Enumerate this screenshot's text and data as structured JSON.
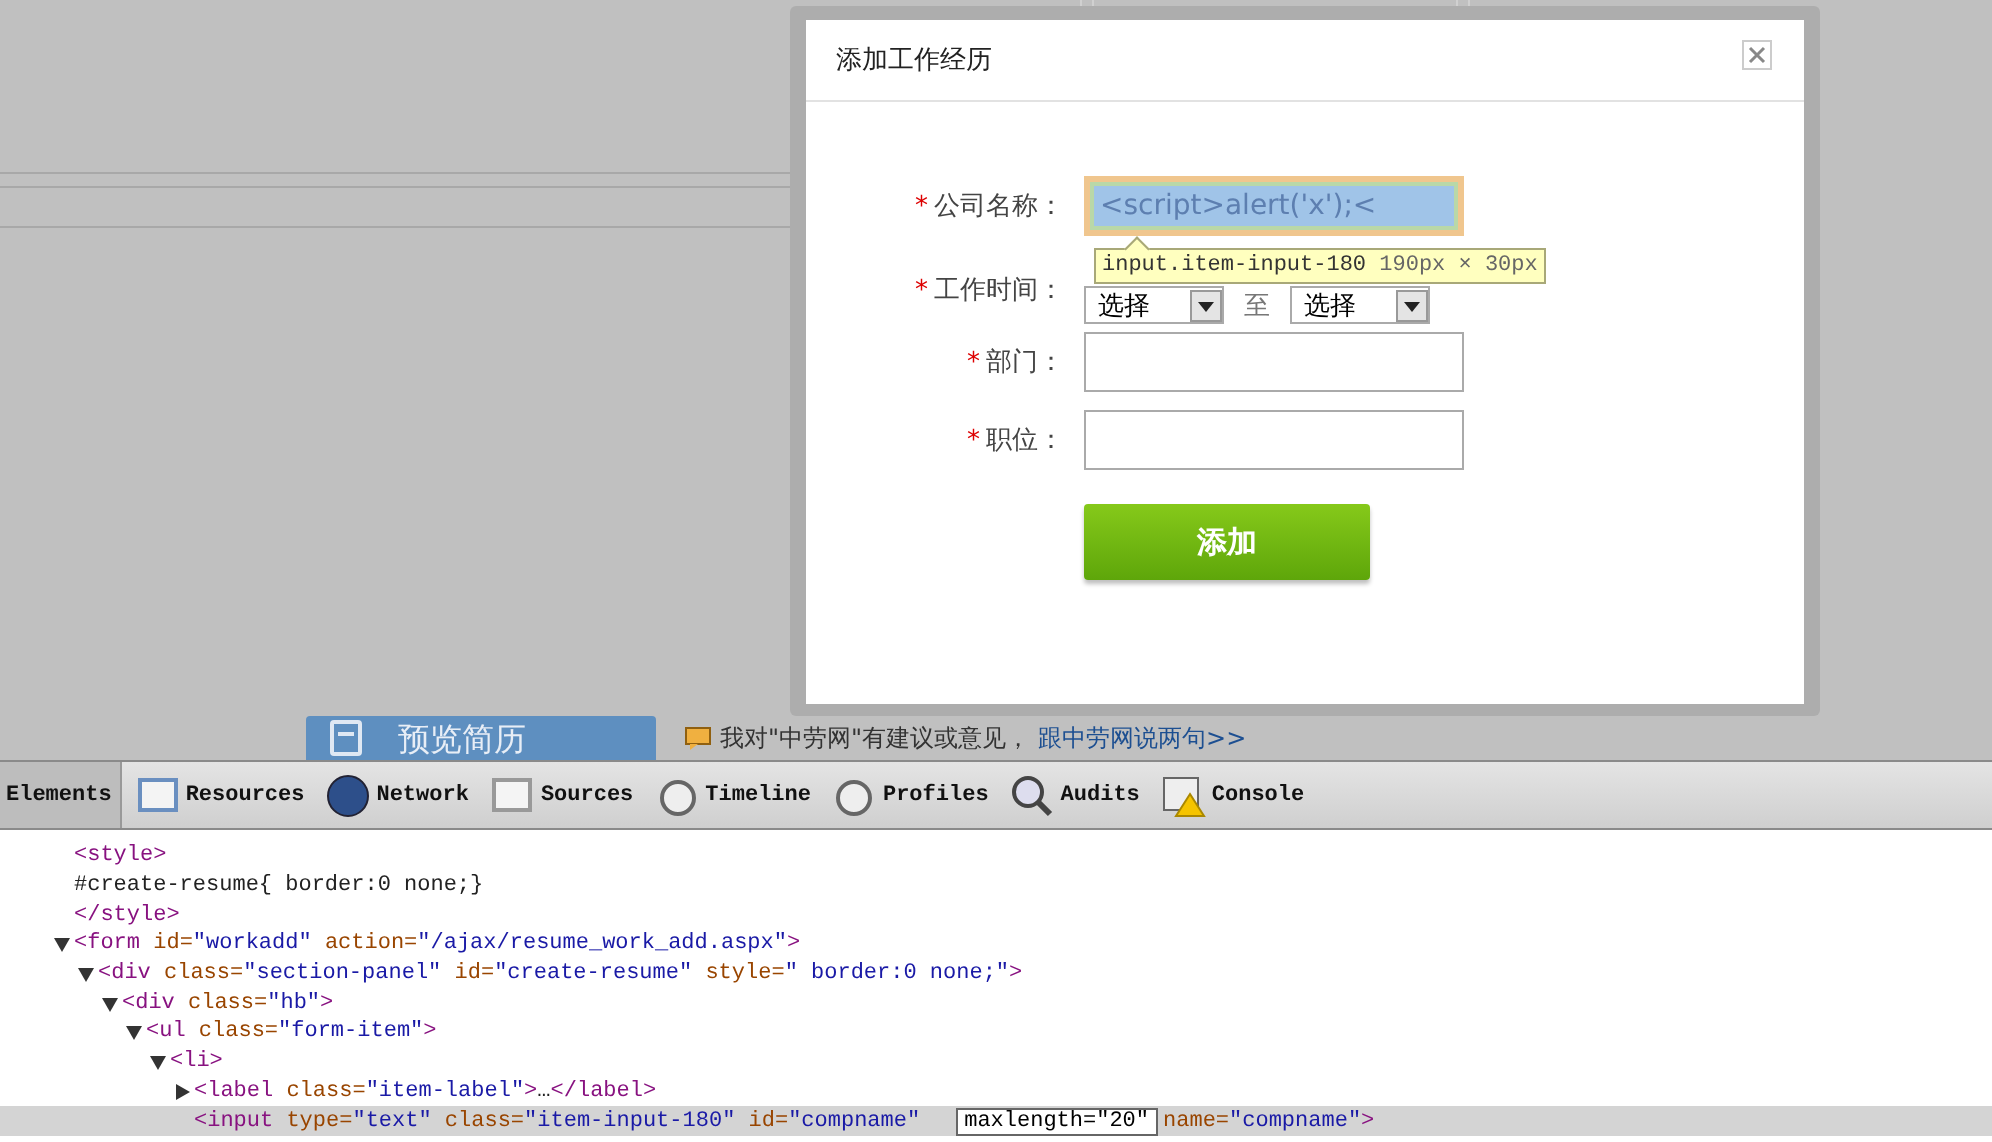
{
  "page": {
    "preview_button": {
      "label": "预览简历"
    },
    "feedback": {
      "text": "我对\"中劳网\"有建议或意见，",
      "link": "跟中劳网说两句>>"
    }
  },
  "dialog": {
    "title": "添加工作经历",
    "fields": [
      {
        "kind": "input",
        "mark": "*",
        "label": "公司名称：",
        "value": "<script>alert('x');<",
        "inspected": true
      },
      {
        "kind": "date-range",
        "mark": "*",
        "label": "工作时间：",
        "from": "选择",
        "separator": "至",
        "to": "选择"
      },
      {
        "kind": "input",
        "mark": "*",
        "label": "部门：",
        "inspected": false
      },
      {
        "kind": "input",
        "mark": "*",
        "label": "职位：",
        "inspected": false
      }
    ],
    "submit": "添加"
  },
  "inspector_tooltip": {
    "selector": "input.item-input-180",
    "size": "190px × 30px"
  },
  "devtools": {
    "tabs": [
      {
        "label": "Elements",
        "selected": true
      },
      {
        "label": "Resources",
        "selected": false
      },
      {
        "label": "Network",
        "selected": false
      },
      {
        "label": "Sources",
        "selected": false
      },
      {
        "label": "Timeline",
        "selected": false
      },
      {
        "label": "Profiles",
        "selected": false
      },
      {
        "label": "Audits",
        "selected": false
      },
      {
        "label": "Console",
        "selected": false
      }
    ],
    "dom_tree": [
      {
        "selected": false,
        "tokens": [
          {
            "kind": "tag",
            "text": "<style>"
          }
        ]
      },
      {
        "selected": false,
        "tokens": [
          {
            "kind": "text",
            "text": "#create-resume{ border:0 none;}"
          }
        ]
      },
      {
        "selected": false,
        "tokens": [
          {
            "kind": "tag",
            "text": "</style>"
          }
        ]
      },
      {
        "selected": false,
        "expanded": true,
        "tokens": [
          {
            "kind": "tag",
            "text": "<form"
          },
          {
            "kind": "attr",
            "text": " id="
          },
          {
            "kind": "value",
            "text": "\"workadd\""
          },
          {
            "kind": "attr",
            "text": " action="
          },
          {
            "kind": "value",
            "text": "\"/ajax/resume_work_add.aspx\""
          },
          {
            "kind": "tag",
            "text": ">"
          }
        ],
        "children": [
          {
            "selected": false,
            "expanded": true,
            "tokens": [
              {
                "kind": "tag",
                "text": "<div"
              },
              {
                "kind": "attr",
                "text": " class="
              },
              {
                "kind": "value",
                "text": "\"section-panel\""
              },
              {
                "kind": "attr",
                "text": " id="
              },
              {
                "kind": "value",
                "text": "\"create-resume\""
              },
              {
                "kind": "attr",
                "text": " style="
              },
              {
                "kind": "value",
                "text": "\" border:0 none;\""
              },
              {
                "kind": "tag",
                "text": ">"
              }
            ],
            "children": [
              {
                "selected": false,
                "expanded": true,
                "tokens": [
                  {
                    "kind": "tag",
                    "text": "<div"
                  },
                  {
                    "kind": "attr",
                    "text": " class="
                  },
                  {
                    "kind": "value",
                    "text": "\"hb\""
                  },
                  {
                    "kind": "tag",
                    "text": ">"
                  }
                ],
                "children": [
                  {
                    "selected": false,
                    "expanded": true,
                    "tokens": [
                      {
                        "kind": "tag",
                        "text": "<ul"
                      },
                      {
                        "kind": "attr",
                        "text": " class="
                      },
                      {
                        "kind": "value",
                        "text": "\"form-item\""
                      },
                      {
                        "kind": "tag",
                        "text": ">"
                      }
                    ],
                    "children": [
                      {
                        "selected": false,
                        "expanded": true,
                        "tokens": [
                          {
                            "kind": "tag",
                            "text": "<li>"
                          }
                        ],
                        "children": [
                          {
                            "selected": false,
                            "expanded": false,
                            "tokens": [
                              {
                                "kind": "tag",
                                "text": "<label"
                              },
                              {
                                "kind": "attr",
                                "text": " class="
                              },
                              {
                                "kind": "value",
                                "text": "\"item-label\""
                              },
                              {
                                "kind": "tag",
                                "text": ">"
                              },
                              {
                                "kind": "text",
                                "text": "…"
                              },
                              {
                                "kind": "tag",
                                "text": "</label>"
                              }
                            ]
                          },
                          {
                            "selected": true,
                            "tokens": [
                              {
                                "kind": "tag",
                                "text": "<input"
                              },
                              {
                                "kind": "attr",
                                "text": " type="
                              },
                              {
                                "kind": "value",
                                "text": "\"text\""
                              },
                              {
                                "kind": "attr",
                                "text": " class="
                              },
                              {
                                "kind": "value",
                                "text": "\"item-input-180\""
                              },
                              {
                                "kind": "attr",
                                "text": " id="
                              },
                              {
                                "kind": "value",
                                "text": "\"compname\""
                              },
                              {
                                "kind": "editing",
                                "text": "maxlength=\"20\""
                              },
                              {
                                "kind": "attr",
                                "text": "name="
                              },
                              {
                                "kind": "value",
                                "text": "\"compname\""
                              },
                              {
                                "kind": "tag",
                                "text": ">"
                              }
                            ]
                          }
                        ]
                      }
                    ]
                  }
                ]
              }
            ]
          }
        ]
      }
    ]
  }
}
